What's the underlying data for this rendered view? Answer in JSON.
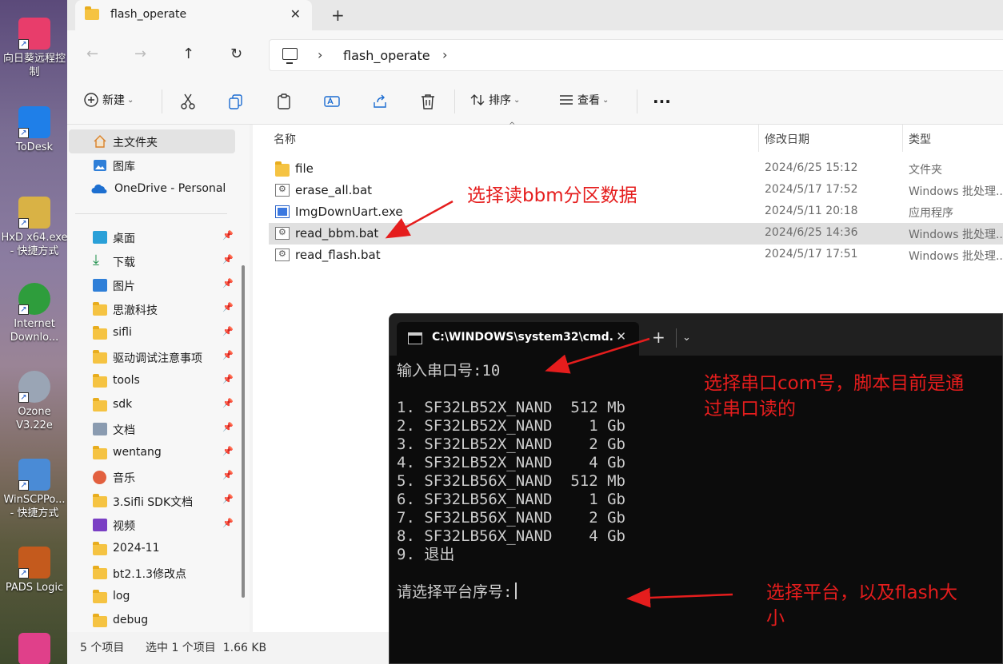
{
  "desktop": {
    "icons": [
      {
        "label": "向日葵远程控\n制",
        "icon": "sunlogin-icon"
      },
      {
        "label": "ToDesk",
        "icon": "todesk-icon"
      },
      {
        "label": "HxD x64.exe\n- 快捷方式",
        "icon": "hxd-icon"
      },
      {
        "label": "Internet\nDownlo...",
        "icon": "idm-icon"
      },
      {
        "label": "Ozone\nV3.22e",
        "icon": "ozone-icon"
      },
      {
        "label": "WinSCPPo...\n- 快捷方式",
        "icon": "winscp-icon"
      },
      {
        "label": "PADS Logic",
        "icon": "pads-icon"
      }
    ]
  },
  "explorer": {
    "tab_title": "flash_operate",
    "breadcrumb": "flash_operate",
    "toolbar": {
      "new_label": "新建",
      "sort_label": "排序",
      "view_label": "查看",
      "more_label": "..."
    },
    "nav": {
      "pinned_top": [
        {
          "label": "主文件夹",
          "icon": "home-icon"
        },
        {
          "label": "图库",
          "icon": "gallery-icon"
        },
        {
          "label": "OneDrive - Personal",
          "icon": "onedrive-icon"
        }
      ],
      "quick": [
        {
          "label": "桌面",
          "icon": "desktop-icon"
        },
        {
          "label": "下载",
          "icon": "download-icon"
        },
        {
          "label": "图片",
          "icon": "pictures-icon"
        },
        {
          "label": "思澈科技",
          "icon": "folder-icon"
        },
        {
          "label": "sifli",
          "icon": "folder-icon"
        },
        {
          "label": "驱动调试注意事项",
          "icon": "folder-icon"
        },
        {
          "label": "tools",
          "icon": "folder-icon"
        },
        {
          "label": "sdk",
          "icon": "folder-icon"
        },
        {
          "label": "文档",
          "icon": "documents-icon"
        },
        {
          "label": "wentang",
          "icon": "folder-icon"
        },
        {
          "label": "音乐",
          "icon": "music-icon"
        },
        {
          "label": "3.Sifli SDK文档",
          "icon": "folder-icon"
        },
        {
          "label": "视频",
          "icon": "videos-icon"
        },
        {
          "label": "2024-11",
          "icon": "folder-icon"
        },
        {
          "label": "bt2.1.3修改点",
          "icon": "folder-icon"
        },
        {
          "label": "log",
          "icon": "folder-icon"
        },
        {
          "label": "debug",
          "icon": "folder-icon"
        }
      ]
    },
    "columns": {
      "name": "名称",
      "date": "修改日期",
      "type": "类型"
    },
    "files": [
      {
        "name": "file",
        "date": "2024/6/25 15:12",
        "type": "文件夹",
        "icon": "folder-icon"
      },
      {
        "name": "erase_all.bat",
        "date": "2024/5/17 17:52",
        "type": "Windows 批处理...",
        "icon": "batch-file-icon"
      },
      {
        "name": "ImgDownUart.exe",
        "date": "2024/5/11 20:18",
        "type": "应用程序",
        "icon": "exe-icon"
      },
      {
        "name": "read_bbm.bat",
        "date": "2024/6/25 14:36",
        "type": "Windows 批处理...",
        "icon": "batch-file-icon"
      },
      {
        "name": "read_flash.bat",
        "date": "2024/5/17 17:51",
        "type": "Windows 批处理...",
        "icon": "batch-file-icon"
      }
    ],
    "status": {
      "count": "5 个项目",
      "selection": "选中 1 个项目  1.66 KB"
    }
  },
  "terminal": {
    "tab_title": "C:\\WINDOWS\\system32\\cmd.",
    "lines": [
      "输入串口号:10",
      "",
      "1. SF32LB52X_NAND  512 Mb",
      "2. SF32LB52X_NAND    1 Gb",
      "3. SF32LB52X_NAND    2 Gb",
      "4. SF32LB52X_NAND    4 Gb",
      "5. SF32LB56X_NAND  512 Mb",
      "6. SF32LB56X_NAND    1 Gb",
      "7. SF32LB56X_NAND    2 Gb",
      "8. SF32LB56X_NAND    4 Gb",
      "9. 退出",
      ""
    ],
    "prompt": "请选择平台序号:"
  },
  "annotations": {
    "a1": "选择读bbm分区数据",
    "a2_line1": "选择串口com号，脚本目前是通",
    "a2_line2": "过串口读的",
    "a3_line1": "选择平台，以及flash大",
    "a3_line2": "小",
    "color": "#e51d1d"
  }
}
